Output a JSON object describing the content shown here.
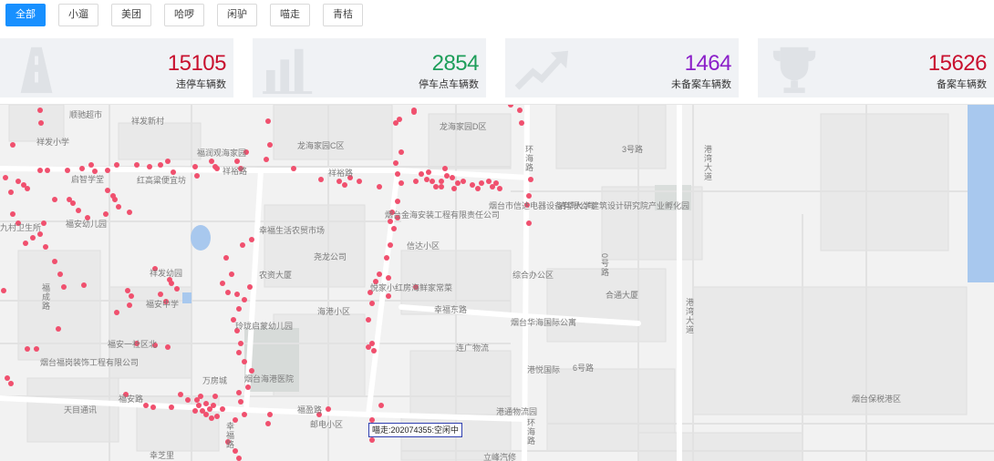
{
  "filters": [
    {
      "label": "全部",
      "active": true
    },
    {
      "label": "小遛",
      "active": false
    },
    {
      "label": "美团",
      "active": false
    },
    {
      "label": "哈啰",
      "active": false
    },
    {
      "label": "闲驴",
      "active": false
    },
    {
      "label": "喵走",
      "active": false
    },
    {
      "label": "青桔",
      "active": false
    }
  ],
  "stats": [
    {
      "value": "15105",
      "label": "违停车辆数",
      "color": "#c8102e",
      "icon": "road-icon"
    },
    {
      "value": "2854",
      "label": "停车点车辆数",
      "color": "#1e9e5a",
      "icon": "bar-chart-icon"
    },
    {
      "value": "1464",
      "label": "未备案车辆数",
      "color": "#8b1fc9",
      "icon": "trend-arrow-icon"
    },
    {
      "value": "15626",
      "label": "备案车辆数",
      "color": "#c8102e",
      "icon": "trophy-icon"
    }
  ],
  "map": {
    "point_color": "#f0506e",
    "labels": [
      "顺驰超市",
      "祥发新村",
      "祥发小学",
      "龙海家园D区",
      "龙海家园C区",
      "福润观海家园",
      "祥裕路",
      "红高粱便宜坊",
      "启智学堂",
      "祥裕路",
      "烟台市信达电器设备有限公司",
      "清华大学建筑设计研究院产业孵化园",
      "环海路",
      "3号路",
      "港湾大道",
      "幸福生活农贸市场",
      "烟台金海安装工程有限责任公司",
      "九村卫生所",
      "福安幼儿园",
      "信达小区",
      "尧龙公司",
      "祥发幼园",
      "农资大厦",
      "综合办公区",
      "0号路",
      "福成路",
      "福安中学",
      "悦家小红房海鲜家常菜",
      "幸福东路",
      "海港小区",
      "合通大厦",
      "烟台华海国际公寓",
      "港湾大道",
      "玲珑启蒙幼儿园",
      "福安一社区北",
      "连广物流",
      "烟台福岗装饰工程有限公司",
      "港悦国际",
      "6号路",
      "万房城",
      "烟台海港医院",
      "天目通讯",
      "福安路",
      "福盈路",
      "邮电小区",
      "港通物流园",
      "环海路",
      "烟台保税港区",
      "幸福路",
      "立峰汽修",
      "幸芝里"
    ],
    "tooltip": "喵走:202074355:空闲中"
  }
}
